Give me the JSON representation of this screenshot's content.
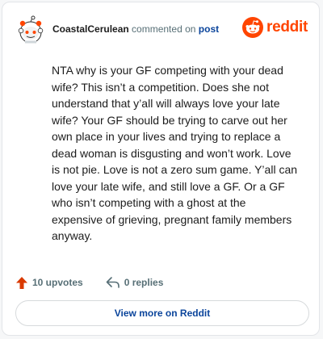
{
  "comment": {
    "username": "CoastalCerulean",
    "action_text": "commented on",
    "post_link": "post",
    "body": "NTA why is your GF competing with your dead wife? This isn’t a competition. Does she not understand that y’all will always love your late wife? Your GF should be trying to carve out her own place in your lives and trying to replace a dead woman is disgusting and won’t work. Love is not pie. Love is not a zero sum game. Y’all can love your late wife, and still love a GF. Or a GF who isn’t competing with a ghost at the expensive of grieving, pregnant family members anyway."
  },
  "brand": {
    "name": "reddit",
    "icon": "reddit-logo-icon",
    "color": "#ff4500"
  },
  "stats": {
    "upvotes": "10 upvotes",
    "upvote_icon": "upvote-arrow-icon",
    "replies": "0 replies",
    "reply_icon": "reply-arrow-icon"
  },
  "actions": {
    "view_more": "View more on Reddit"
  },
  "colors": {
    "accent": "#ff4500",
    "link": "#0a449b",
    "muted": "#576f76"
  }
}
